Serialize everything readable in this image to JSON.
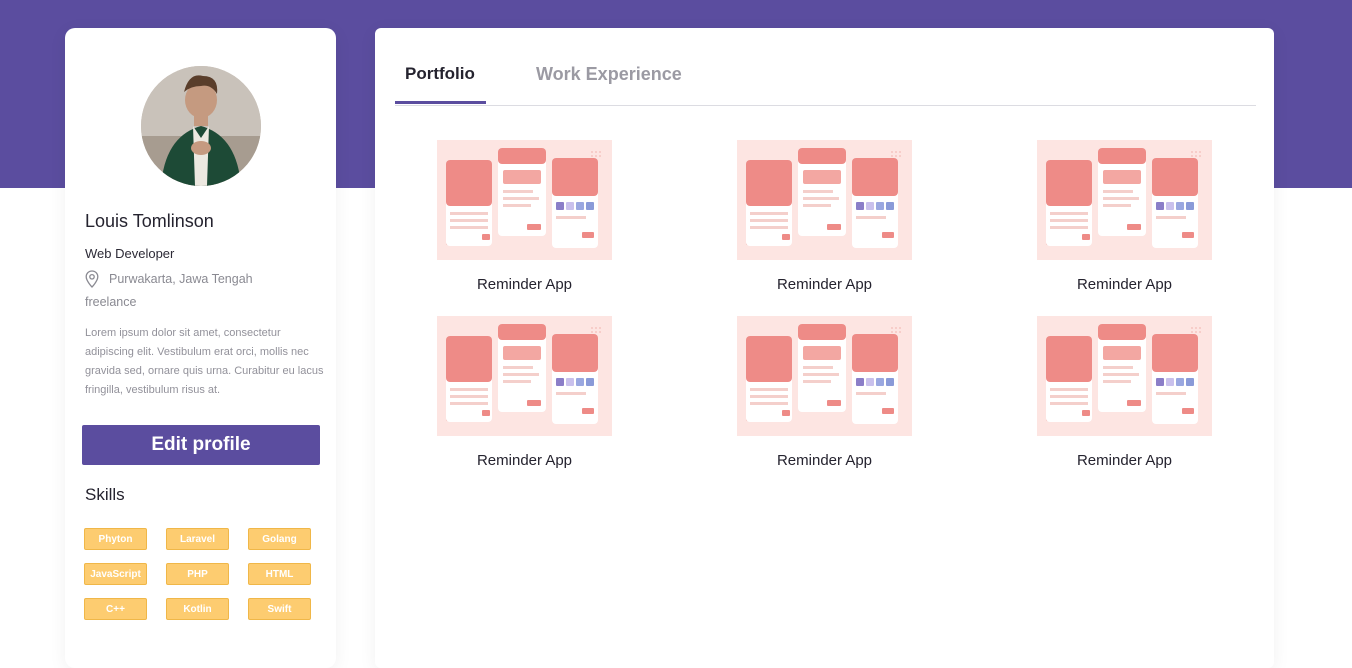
{
  "colors": {
    "brand": "#5b4d9f",
    "skill_chip": "#fdcc70",
    "thumb_bg": "#fde5e2",
    "thumb_accent": "#ee8b87"
  },
  "profile": {
    "name": "Louis Tomlinson",
    "role": "Web Developer",
    "location": "Purwakarta, Jawa Tengah",
    "employment": "freelance",
    "bio": "Lorem ipsum dolor sit amet, consectetur adipiscing elit. Vestibulum erat orci, mollis nec gravida sed, ornare quis urna. Curabitur eu lacus fringilla, vestibulum risus at.",
    "edit_button": "Edit profile",
    "skills_title": "Skills",
    "skills": [
      "Phyton",
      "Laravel",
      "Golang",
      "JavaScript",
      "PHP",
      "HTML",
      "C++",
      "Kotlin",
      "Swift"
    ]
  },
  "tabs": [
    {
      "label": "Portfolio",
      "active": true
    },
    {
      "label": "Work Experience",
      "active": false
    }
  ],
  "portfolio": [
    {
      "title": "Reminder App"
    },
    {
      "title": "Reminder App"
    },
    {
      "title": "Reminder App"
    },
    {
      "title": "Reminder App"
    },
    {
      "title": "Reminder App"
    },
    {
      "title": "Reminder App"
    }
  ]
}
